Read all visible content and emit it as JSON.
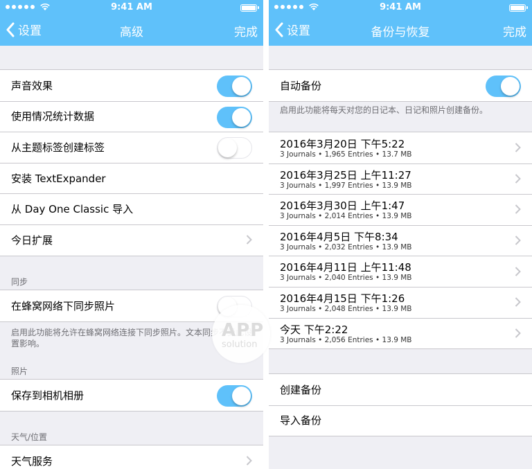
{
  "status_bar": {
    "time": "9:41 AM"
  },
  "left": {
    "nav": {
      "back": "设置",
      "title": "高级",
      "done": "完成"
    },
    "group1": [
      {
        "label": "声音效果",
        "accessory": "toggle",
        "on": true
      },
      {
        "label": "使用情况统计数据",
        "accessory": "toggle",
        "on": true
      },
      {
        "label": "从主题标签创建标签",
        "accessory": "toggle",
        "on": false
      },
      {
        "label": "安装 TextExpander",
        "accessory": "none"
      },
      {
        "label": "从 Day One Classic 导入",
        "accessory": "none"
      },
      {
        "label": "今日扩展",
        "accessory": "chevron"
      }
    ],
    "sync": {
      "header": "同步",
      "row": {
        "label": "在蜂窝网络下同步照片",
        "on": false
      },
      "footer": "启用此功能将允许在蜂窝网络连接下同步照片。文本同步不受此设置影响。"
    },
    "photos": {
      "header": "照片",
      "row": {
        "label": "保存到相机相册",
        "on": true
      }
    },
    "weather": {
      "header": "天气/位置",
      "row": {
        "label": "天气服务"
      }
    }
  },
  "right": {
    "nav": {
      "back": "设置",
      "title": "备份与恢复",
      "done": "完成"
    },
    "auto_backup": {
      "label": "自动备份",
      "on": true
    },
    "auto_footer": "启用此功能将每天对您的日记本、日记和照片创建备份。",
    "backups": [
      {
        "date": "2016年3月20日 下午5:22",
        "detail": "3 Journals • 1,965 Entries • 13.7 MB"
      },
      {
        "date": "2016年3月25日 上午11:27",
        "detail": "3 Journals • 1,997 Entries • 13.9 MB"
      },
      {
        "date": "2016年3月30日 上午1:47",
        "detail": "3 Journals • 2,014 Entries • 13.9 MB"
      },
      {
        "date": "2016年4月5日 下午8:34",
        "detail": "3 Journals • 2,032 Entries • 13.9 MB"
      },
      {
        "date": "2016年4月11日 上午11:48",
        "detail": "3 Journals • 2,040 Entries • 13.9 MB"
      },
      {
        "date": "2016年4月15日 下午1:26",
        "detail": "3 Journals • 2,048 Entries • 13.9 MB"
      },
      {
        "date": "今天 下午2:22",
        "detail": "3 Journals • 2,056 Entries • 13.9 MB"
      }
    ],
    "actions": {
      "create": "创建备份",
      "import": "导入备份"
    }
  },
  "watermark": {
    "line1": "APP",
    "line2": "solution"
  },
  "colors": {
    "accent": "#5fc1fa",
    "background": "#efeff4",
    "separator": "#c8c7cc",
    "secondary_text": "#6d6d72"
  }
}
